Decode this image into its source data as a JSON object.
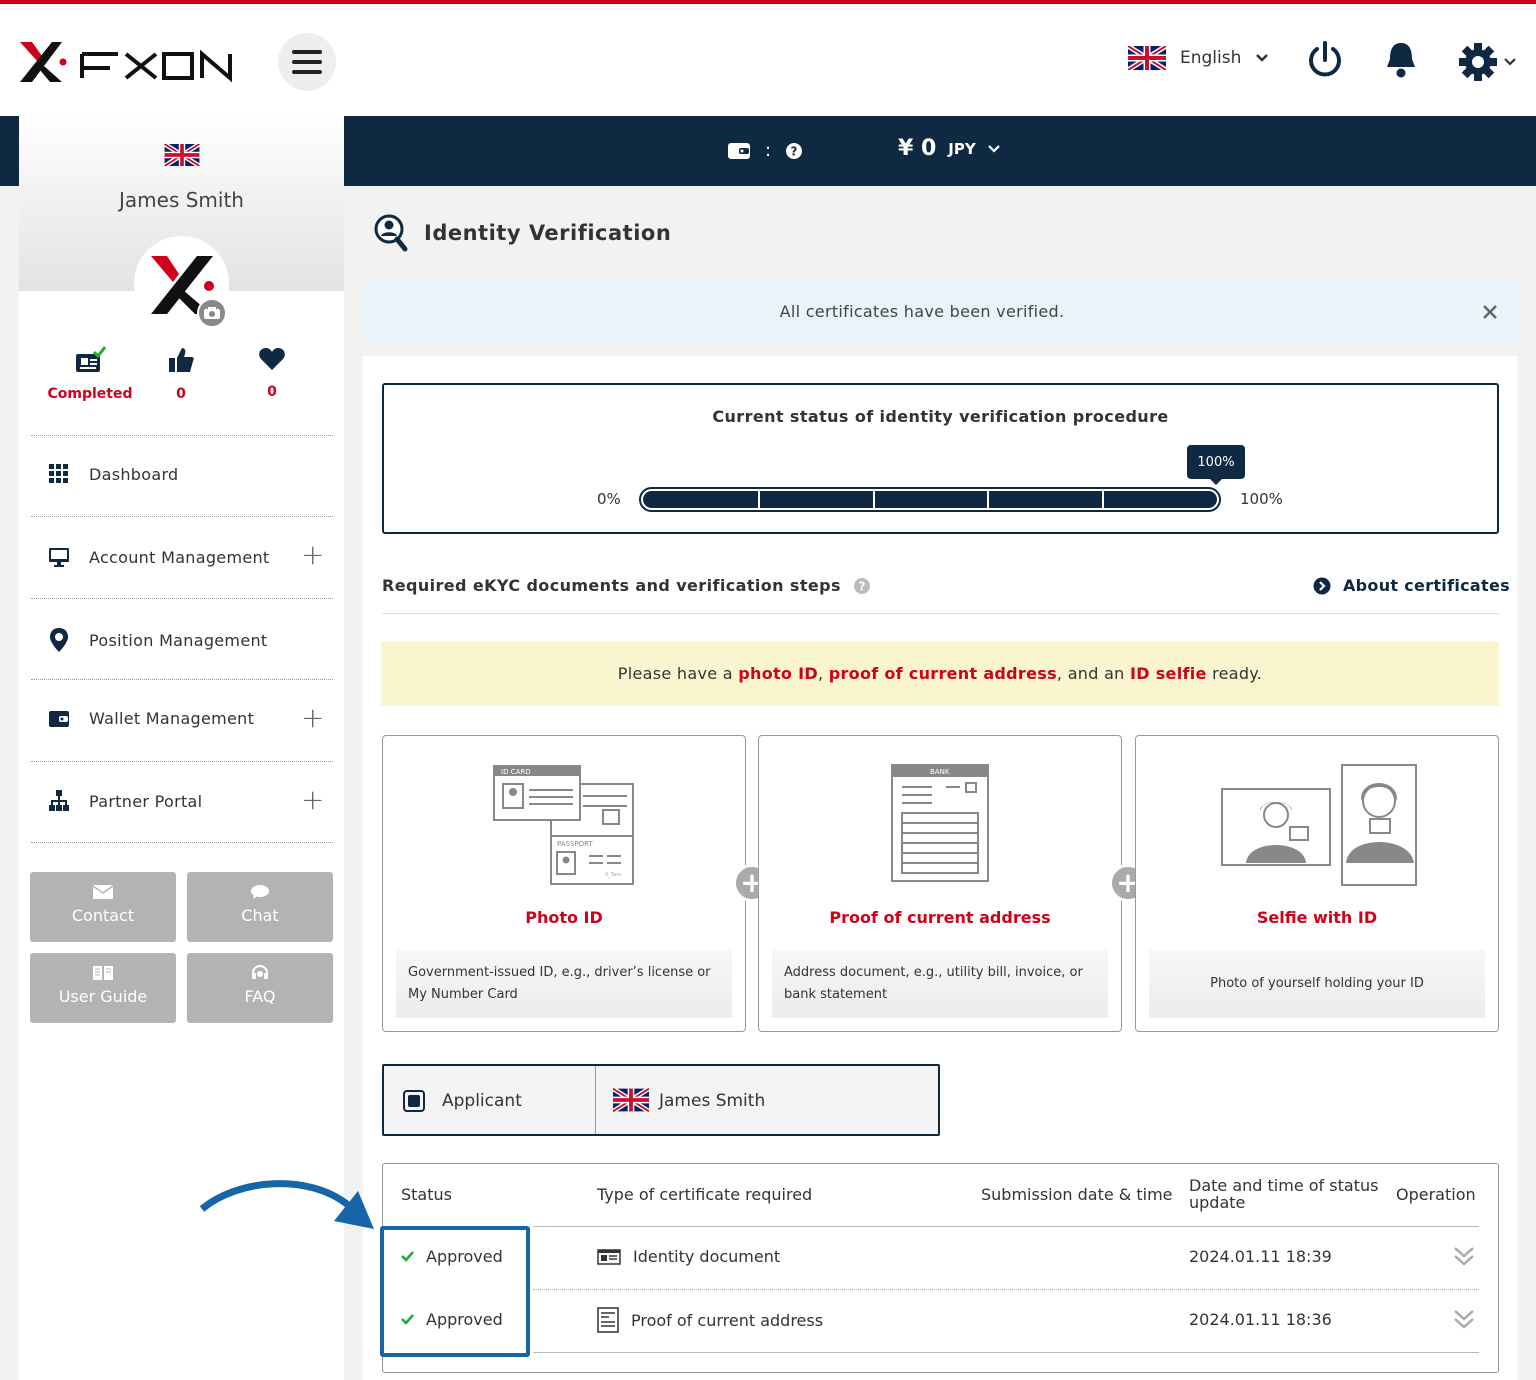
{
  "header": {
    "language": "English",
    "logo_text": "FXON"
  },
  "balance_bar": {
    "wallet_separator": ":",
    "amount": "¥ 0",
    "currency": "JPY"
  },
  "sidebar": {
    "user_name": "James Smith",
    "stats": [
      {
        "icon": "id-card-check-icon",
        "value": "Completed"
      },
      {
        "icon": "thumbs-up-icon",
        "value": "0"
      },
      {
        "icon": "heart-icon",
        "value": "0"
      }
    ],
    "nav": [
      {
        "label": "Dashboard",
        "icon": "grid-icon",
        "expandable": false
      },
      {
        "label": "Account Management",
        "icon": "monitor-icon",
        "expandable": true
      },
      {
        "label": "Position Management",
        "icon": "map-pin-icon",
        "expandable": false
      },
      {
        "label": "Wallet Management",
        "icon": "wallet-icon",
        "expandable": true
      },
      {
        "label": "Partner Portal",
        "icon": "org-chart-icon",
        "expandable": true
      }
    ],
    "buttons": [
      {
        "label": "Contact",
        "icon": "envelope-icon"
      },
      {
        "label": "Chat",
        "icon": "chat-bubble-icon"
      },
      {
        "label": "User Guide",
        "icon": "book-icon"
      },
      {
        "label": "FAQ",
        "icon": "headset-icon"
      }
    ]
  },
  "page": {
    "title": "Identity Verification",
    "alert": "All certificates have been verified.",
    "status_title": "Current status of identity verification procedure",
    "progress": {
      "min_label": "0%",
      "max_label": "100%",
      "value_label": "100%",
      "value": 1.0
    },
    "docs_heading": "Required eKYC documents and verification steps",
    "about_link": "About certificates",
    "notice": {
      "pre": "Please have a ",
      "item1": "photo ID",
      "sep1": ", ",
      "item2": "proof of current address",
      "sep2": ", and an ",
      "item3": "ID selfie",
      "post": " ready."
    },
    "documents": [
      {
        "title": "Photo ID",
        "desc": "Government-issued ID, e.g., driver’s license or My Number Card",
        "img_label_1": "ID CARD",
        "img_label_2": "PASSPORT",
        "img_label_3": "X_Taro"
      },
      {
        "title": "Proof of current address",
        "desc": "Address document, e.g., utility bill, invoice, or bank statement",
        "img_label_1": "BANK"
      },
      {
        "title": "Selfie with ID",
        "desc": "Photo of yourself holding your ID"
      }
    ],
    "applicant": {
      "label": "Applicant",
      "name": "James Smith"
    },
    "table": {
      "headers": [
        "Status",
        "Type of certificate required",
        "Submission date & time",
        "Date and time of status update",
        "Operation"
      ],
      "rows": [
        {
          "status": "Approved",
          "type": "Identity document",
          "submitted": "",
          "updated": "2024.01.11 18:39"
        },
        {
          "status": "Approved",
          "type": "Proof of current address",
          "submitted": "",
          "updated": "2024.01.11 18:36"
        }
      ]
    }
  },
  "colors": {
    "accent_red": "#d0021b",
    "navy": "#0f2942",
    "highlight_blue": "#1565a8",
    "approved_green": "#22aa33"
  }
}
